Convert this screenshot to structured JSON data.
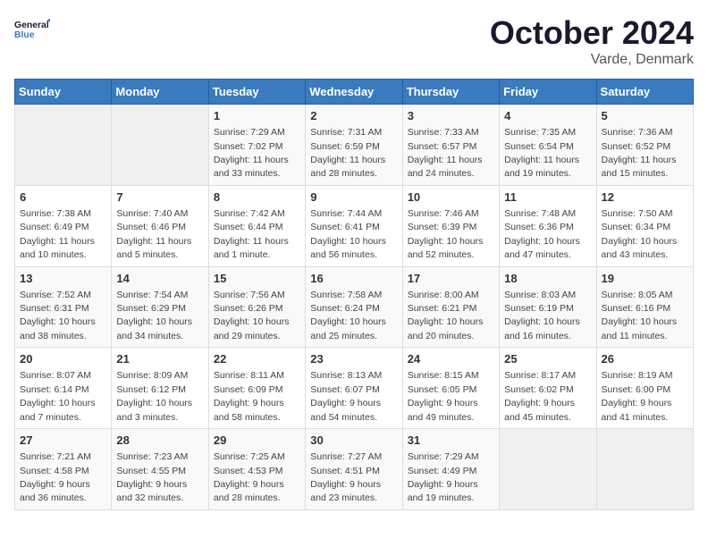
{
  "header": {
    "logo_line1": "General",
    "logo_line2": "Blue",
    "month": "October 2024",
    "location": "Varde, Denmark"
  },
  "days_of_week": [
    "Sunday",
    "Monday",
    "Tuesday",
    "Wednesday",
    "Thursday",
    "Friday",
    "Saturday"
  ],
  "weeks": [
    {
      "cells": [
        {
          "day": "",
          "detail": ""
        },
        {
          "day": "",
          "detail": ""
        },
        {
          "day": "1",
          "detail": "Sunrise: 7:29 AM\nSunset: 7:02 PM\nDaylight: 11 hours and 33 minutes."
        },
        {
          "day": "2",
          "detail": "Sunrise: 7:31 AM\nSunset: 6:59 PM\nDaylight: 11 hours and 28 minutes."
        },
        {
          "day": "3",
          "detail": "Sunrise: 7:33 AM\nSunset: 6:57 PM\nDaylight: 11 hours and 24 minutes."
        },
        {
          "day": "4",
          "detail": "Sunrise: 7:35 AM\nSunset: 6:54 PM\nDaylight: 11 hours and 19 minutes."
        },
        {
          "day": "5",
          "detail": "Sunrise: 7:36 AM\nSunset: 6:52 PM\nDaylight: 11 hours and 15 minutes."
        }
      ]
    },
    {
      "cells": [
        {
          "day": "6",
          "detail": "Sunrise: 7:38 AM\nSunset: 6:49 PM\nDaylight: 11 hours and 10 minutes."
        },
        {
          "day": "7",
          "detail": "Sunrise: 7:40 AM\nSunset: 6:46 PM\nDaylight: 11 hours and 5 minutes."
        },
        {
          "day": "8",
          "detail": "Sunrise: 7:42 AM\nSunset: 6:44 PM\nDaylight: 11 hours and 1 minute."
        },
        {
          "day": "9",
          "detail": "Sunrise: 7:44 AM\nSunset: 6:41 PM\nDaylight: 10 hours and 56 minutes."
        },
        {
          "day": "10",
          "detail": "Sunrise: 7:46 AM\nSunset: 6:39 PM\nDaylight: 10 hours and 52 minutes."
        },
        {
          "day": "11",
          "detail": "Sunrise: 7:48 AM\nSunset: 6:36 PM\nDaylight: 10 hours and 47 minutes."
        },
        {
          "day": "12",
          "detail": "Sunrise: 7:50 AM\nSunset: 6:34 PM\nDaylight: 10 hours and 43 minutes."
        }
      ]
    },
    {
      "cells": [
        {
          "day": "13",
          "detail": "Sunrise: 7:52 AM\nSunset: 6:31 PM\nDaylight: 10 hours and 38 minutes."
        },
        {
          "day": "14",
          "detail": "Sunrise: 7:54 AM\nSunset: 6:29 PM\nDaylight: 10 hours and 34 minutes."
        },
        {
          "day": "15",
          "detail": "Sunrise: 7:56 AM\nSunset: 6:26 PM\nDaylight: 10 hours and 29 minutes."
        },
        {
          "day": "16",
          "detail": "Sunrise: 7:58 AM\nSunset: 6:24 PM\nDaylight: 10 hours and 25 minutes."
        },
        {
          "day": "17",
          "detail": "Sunrise: 8:00 AM\nSunset: 6:21 PM\nDaylight: 10 hours and 20 minutes."
        },
        {
          "day": "18",
          "detail": "Sunrise: 8:03 AM\nSunset: 6:19 PM\nDaylight: 10 hours and 16 minutes."
        },
        {
          "day": "19",
          "detail": "Sunrise: 8:05 AM\nSunset: 6:16 PM\nDaylight: 10 hours and 11 minutes."
        }
      ]
    },
    {
      "cells": [
        {
          "day": "20",
          "detail": "Sunrise: 8:07 AM\nSunset: 6:14 PM\nDaylight: 10 hours and 7 minutes."
        },
        {
          "day": "21",
          "detail": "Sunrise: 8:09 AM\nSunset: 6:12 PM\nDaylight: 10 hours and 3 minutes."
        },
        {
          "day": "22",
          "detail": "Sunrise: 8:11 AM\nSunset: 6:09 PM\nDaylight: 9 hours and 58 minutes."
        },
        {
          "day": "23",
          "detail": "Sunrise: 8:13 AM\nSunset: 6:07 PM\nDaylight: 9 hours and 54 minutes."
        },
        {
          "day": "24",
          "detail": "Sunrise: 8:15 AM\nSunset: 6:05 PM\nDaylight: 9 hours and 49 minutes."
        },
        {
          "day": "25",
          "detail": "Sunrise: 8:17 AM\nSunset: 6:02 PM\nDaylight: 9 hours and 45 minutes."
        },
        {
          "day": "26",
          "detail": "Sunrise: 8:19 AM\nSunset: 6:00 PM\nDaylight: 9 hours and 41 minutes."
        }
      ]
    },
    {
      "cells": [
        {
          "day": "27",
          "detail": "Sunrise: 7:21 AM\nSunset: 4:58 PM\nDaylight: 9 hours and 36 minutes."
        },
        {
          "day": "28",
          "detail": "Sunrise: 7:23 AM\nSunset: 4:55 PM\nDaylight: 9 hours and 32 minutes."
        },
        {
          "day": "29",
          "detail": "Sunrise: 7:25 AM\nSunset: 4:53 PM\nDaylight: 9 hours and 28 minutes."
        },
        {
          "day": "30",
          "detail": "Sunrise: 7:27 AM\nSunset: 4:51 PM\nDaylight: 9 hours and 23 minutes."
        },
        {
          "day": "31",
          "detail": "Sunrise: 7:29 AM\nSunset: 4:49 PM\nDaylight: 9 hours and 19 minutes."
        },
        {
          "day": "",
          "detail": ""
        },
        {
          "day": "",
          "detail": ""
        }
      ]
    }
  ]
}
